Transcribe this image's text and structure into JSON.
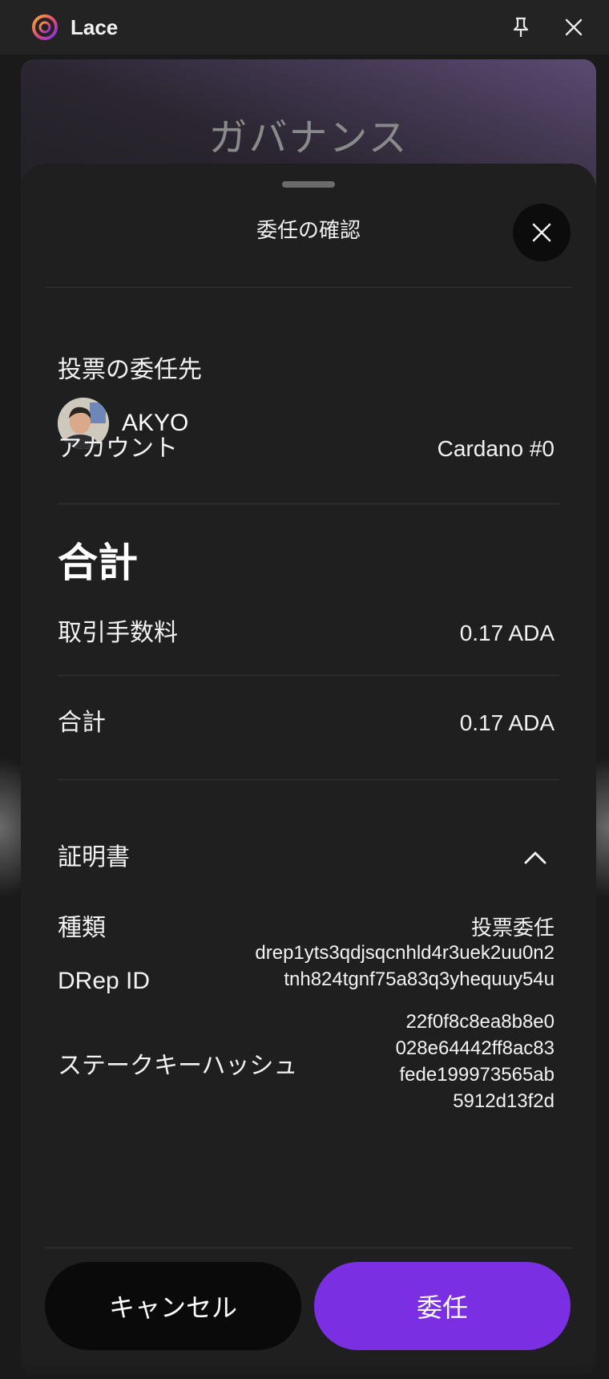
{
  "window": {
    "app_name": "Lace",
    "pin_icon": "pin-icon",
    "close_icon": "close-icon"
  },
  "background_page": {
    "title": "ガバナンス"
  },
  "drawer": {
    "title": "委任の確認",
    "delegate_to_label": "投票の委任先",
    "drep_name": "AKYO",
    "account_label": "アカウント",
    "account_value": "Cardano #0",
    "total_heading": "合計",
    "fee_label": "取引手数料",
    "fee_value": "0.17 ADA",
    "total_label": "合計",
    "total_value": "0.17 ADA",
    "certificate_label": "証明書",
    "type_label": "種類",
    "type_value": "投票委任",
    "drep_id_label": "DRep ID",
    "drep_id_lines": [
      "drep1yts3qdjsqcnhld4r3uek2uu0n2",
      "tnh824tgnf75a83q3yhequuy54u"
    ],
    "stake_key_label": "ステークキーハッシュ",
    "stake_key_lines": [
      "22f0f8c8ea8b8e0",
      "028e64442ff8ac83",
      "fede199973565ab",
      "5912d13f2d"
    ],
    "cancel_label": "キャンセル",
    "delegate_label": "委任"
  },
  "colors": {
    "accent": "#7b2fe3",
    "drawer_bg": "#1f1f1f",
    "title_bar": "#232323"
  }
}
